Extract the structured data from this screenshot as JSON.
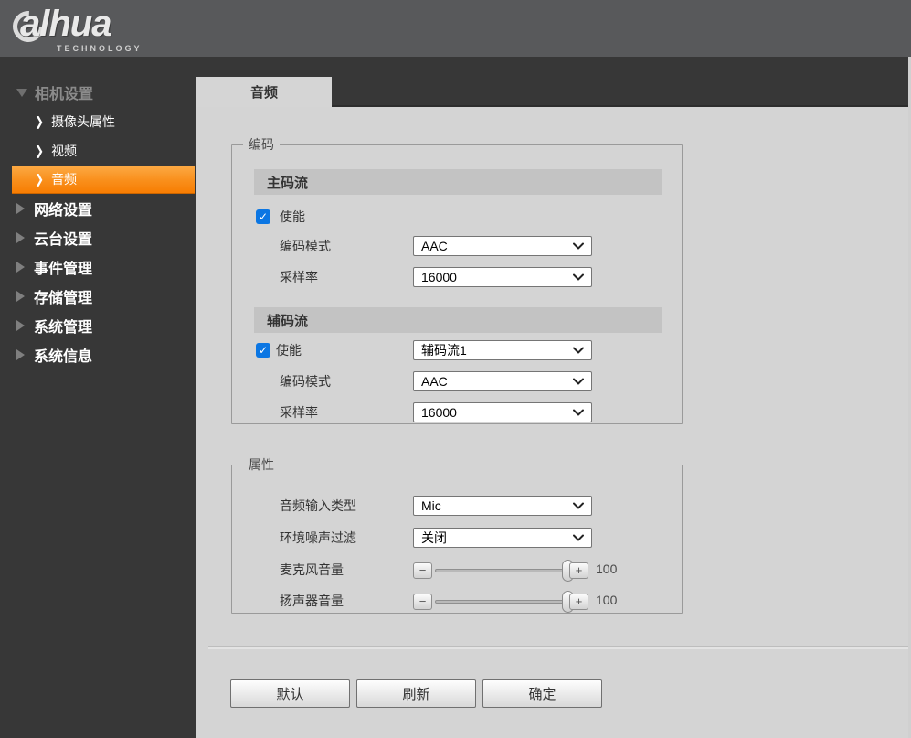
{
  "header": {
    "logo_text": "alhua",
    "logo_sub": "TECHNOLOGY"
  },
  "sidebar": {
    "groups": [
      {
        "label": "相机设置",
        "expanded": true,
        "children": [
          {
            "label": "摄像头属性",
            "selected": false
          },
          {
            "label": "视频",
            "selected": false
          },
          {
            "label": "音频",
            "selected": true
          }
        ]
      },
      {
        "label": "网络设置",
        "expanded": false
      },
      {
        "label": "云台设置",
        "expanded": false
      },
      {
        "label": "事件管理",
        "expanded": false
      },
      {
        "label": "存储管理",
        "expanded": false
      },
      {
        "label": "系统管理",
        "expanded": false
      },
      {
        "label": "系统信息",
        "expanded": false
      }
    ]
  },
  "tabs": [
    {
      "label": "音频",
      "active": true
    }
  ],
  "encoding": {
    "legend": "编码",
    "main_stream": {
      "title": "主码流",
      "enable_label": "使能",
      "enable_checked": true,
      "fields": [
        {
          "label": "编码模式",
          "value": "AAC"
        },
        {
          "label": "采样率",
          "value": "16000"
        }
      ]
    },
    "sub_stream": {
      "title": "辅码流",
      "enable_label": "使能",
      "enable_checked": true,
      "enable_value": "辅码流1",
      "fields": [
        {
          "label": "编码模式",
          "value": "AAC"
        },
        {
          "label": "采样率",
          "value": "16000"
        }
      ]
    }
  },
  "attribute": {
    "legend": "属性",
    "selects": [
      {
        "label": "音频输入类型",
        "value": "Mic"
      },
      {
        "label": "环境噪声过滤",
        "value": "关闭"
      }
    ],
    "sliders": [
      {
        "label": "麦克风音量",
        "value": "100",
        "percent": 100
      },
      {
        "label": "扬声器音量",
        "value": "100",
        "percent": 100
      }
    ]
  },
  "footer_buttons": [
    {
      "label": "默认"
    },
    {
      "label": "刷新"
    },
    {
      "label": "确定"
    }
  ],
  "icons": {
    "check": "✓",
    "minus": "−",
    "plus": "+",
    "chevron_right": "❯"
  },
  "colors": {
    "header_bg": "#58595b",
    "sidebar_bg": "#373737",
    "content_bg": "#d4d4d4",
    "selected_orange_top": "#fcaa45",
    "selected_orange_bottom": "#f87d02",
    "checkbox_blue": "#0b76e3",
    "stream_bar_bg": "#c3c3c3"
  }
}
